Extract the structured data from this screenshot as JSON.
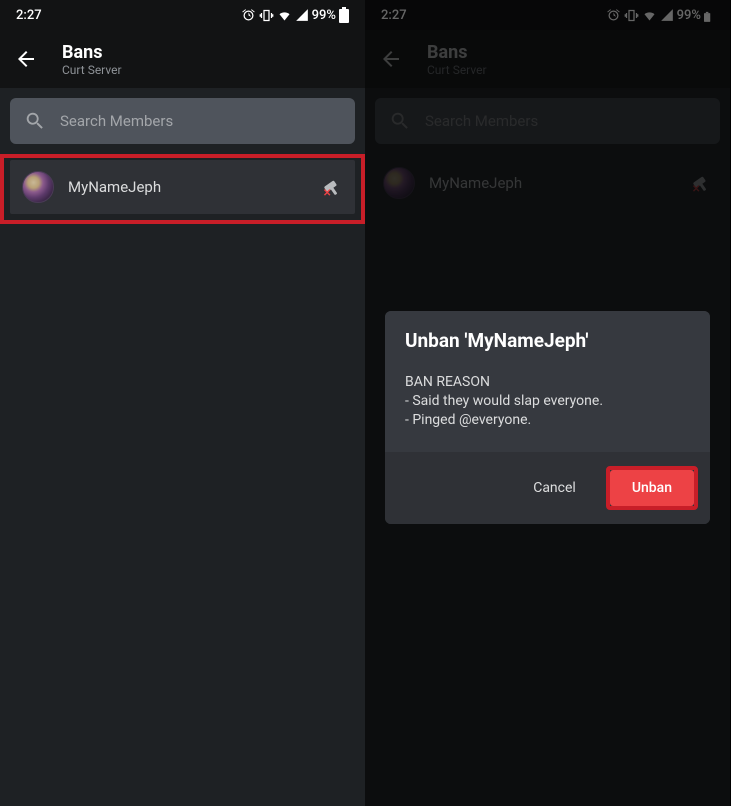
{
  "status": {
    "time": "2:27",
    "battery_pct": "99%"
  },
  "header": {
    "title": "Bans",
    "subtitle": "Curt Server"
  },
  "search": {
    "placeholder": "Search Members"
  },
  "members": [
    {
      "name": "MyNameJeph"
    }
  ],
  "modal": {
    "title": "Unban 'MyNameJeph'",
    "reason_label": "BAN REASON",
    "reason_lines": [
      "- Said they would slap everyone.",
      "- Pinged @everyone."
    ],
    "cancel_label": "Cancel",
    "unban_label": "Unban"
  }
}
